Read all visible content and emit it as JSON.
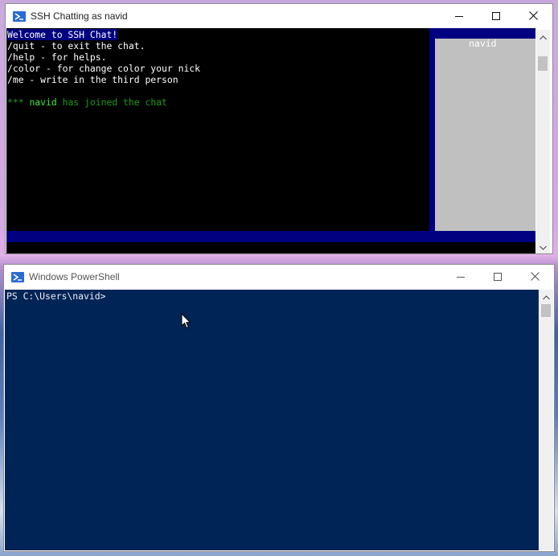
{
  "ssh_window": {
    "title": "SSH Chatting as navid",
    "minimize_icon": "minimize-icon",
    "maximize_icon": "maximize-icon",
    "close_icon": "close-icon",
    "chat_lines": [
      {
        "text": "Welcome to SSH Chat!",
        "color": "#ffffff",
        "highlight": "#000080"
      },
      {
        "text": "/quit - to exit the chat.",
        "color": "#ffffff"
      },
      {
        "text": "/help - for helps.",
        "color": "#ffffff"
      },
      {
        "text": "/color - for change color your nick",
        "color": "#ffffff"
      },
      {
        "text": "/me - write in the third person",
        "color": "#ffffff"
      },
      {
        "text": "",
        "color": "#ffffff"
      }
    ],
    "join_message": {
      "prefix": "***",
      "nick": "navid",
      "suffix": "has joined the chat",
      "prefix_color": "#1a9e1a",
      "nick_color": "#3ee83e",
      "suffix_color": "#1a9e1a"
    },
    "user_list_header": "navid",
    "input_value": "",
    "colors": {
      "chat_background": "#000000",
      "user_list_background": "#c0c0c0",
      "header_background": "#000080",
      "input_background": "#000080"
    }
  },
  "powershell_window": {
    "title": "Windows PowerShell",
    "minimize_icon": "minimize-icon",
    "maximize_icon": "maximize-icon",
    "close_icon": "close-icon",
    "prompt": "PS C:\\Users\\navid>",
    "colors": {
      "background": "#012456",
      "text": "#eeedf0"
    }
  }
}
